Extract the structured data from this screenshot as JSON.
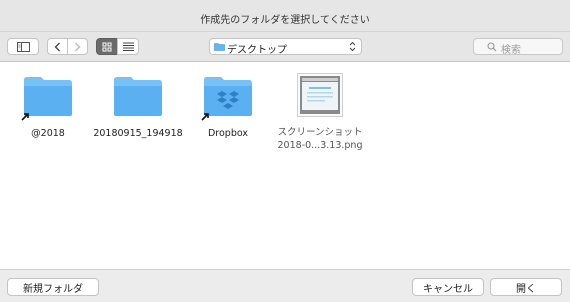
{
  "window": {
    "title": "作成先のフォルダを選択してください"
  },
  "toolbar": {
    "location": "デスクトップ",
    "search_placeholder": "検索"
  },
  "files": [
    {
      "name": "@2018",
      "type": "folder-alias"
    },
    {
      "name": "20180915_194918",
      "type": "folder"
    },
    {
      "name": "Dropbox",
      "type": "dropbox-folder-alias"
    },
    {
      "name_line1": "スクリーンショット",
      "name_line2": "2018-0...3.13.png",
      "type": "image"
    }
  ],
  "footer": {
    "new_folder": "新規フォルダ",
    "cancel": "キャンセル",
    "open": "開く"
  },
  "colors": {
    "folder": "#5ab0f0",
    "folder_tab": "#76c1f5",
    "selected_segment": "#6b6b6b"
  }
}
